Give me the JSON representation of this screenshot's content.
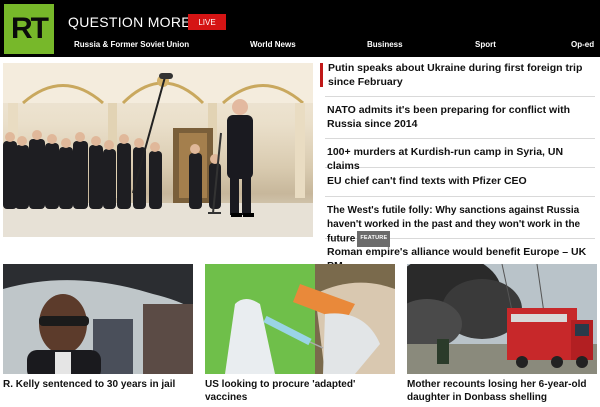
{
  "header": {
    "logo_text": "RT",
    "tagline": "QUESTION MORE",
    "live_label": "LIVE",
    "nav": [
      "Russia & Former Soviet Union",
      "World News",
      "Business",
      "Sport",
      "Op-ed"
    ]
  },
  "colors": {
    "brand_green": "#77b82a",
    "live_red": "#d51414",
    "accent_red": "#c01818",
    "header_bg": "#000000"
  },
  "headlines": [
    {
      "title": "Putin speaks about Ukraine during first foreign trip since February"
    },
    {
      "title": "NATO admits it's been preparing for conflict with Russia since 2014"
    },
    {
      "title": "100+ murders at Kurdish-run camp in Syria, UN claims"
    },
    {
      "title": "EU chief can't find texts with Pfizer CEO"
    },
    {
      "title": "The West's futile folly: Why sanctions against Russia haven't worked in the past and they won't work in the future",
      "badge": "FEATURE"
    },
    {
      "title": "Roman empire's alliance would benefit Europe – UK PM"
    }
  ],
  "cards": [
    {
      "title": "R. Kelly sentenced to 30 years in jail"
    },
    {
      "title": "US looking to procure 'adapted' vaccines"
    },
    {
      "title": "Mother recounts losing her 6-year-old daughter in Donbass shelling"
    }
  ]
}
